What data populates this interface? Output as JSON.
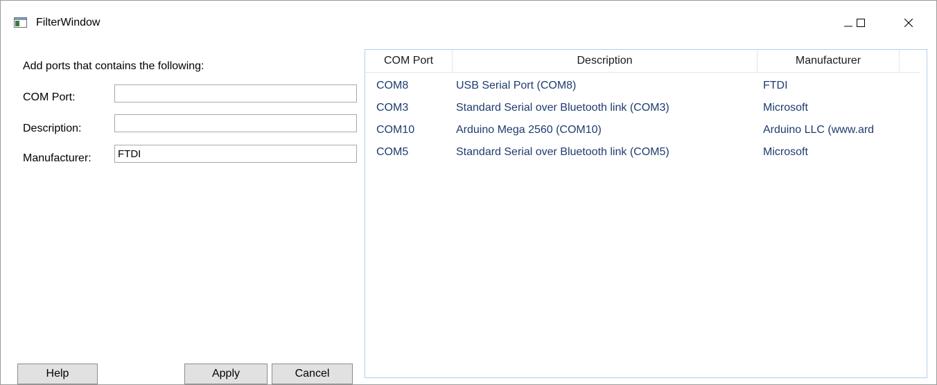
{
  "window": {
    "title": "FilterWindow"
  },
  "filter": {
    "heading": "Add ports that contains the following:",
    "com_port_label": "COM Port:",
    "com_port_value": "",
    "description_label": "Description:",
    "description_value": "",
    "manufacturer_label": "Manufacturer:",
    "manufacturer_value": "FTDI"
  },
  "buttons": {
    "help": "Help",
    "apply": "Apply",
    "cancel": "Cancel"
  },
  "ports_list": {
    "columns": [
      "COM Port",
      "Description",
      "Manufacturer"
    ],
    "rows": [
      {
        "port": "COM8",
        "description": "USB Serial Port (COM8)",
        "manufacturer": "FTDI"
      },
      {
        "port": "COM3",
        "description": "Standard Serial over Bluetooth link (COM3)",
        "manufacturer": "Microsoft"
      },
      {
        "port": "COM10",
        "description": "Arduino Mega 2560 (COM10)",
        "manufacturer": "Arduino LLC (www.ard"
      },
      {
        "port": "COM5",
        "description": "Standard Serial over Bluetooth link (COM5)",
        "manufacturer": "Microsoft"
      }
    ]
  },
  "icons": {
    "app": "app-window-icon",
    "minimize": "minimize-icon",
    "maximize": "maximize-icon",
    "close": "close-icon"
  },
  "colors": {
    "list_text": "#1e3b6f",
    "list_border": "#b5cfe5",
    "button_bg": "#e1e1e1"
  }
}
